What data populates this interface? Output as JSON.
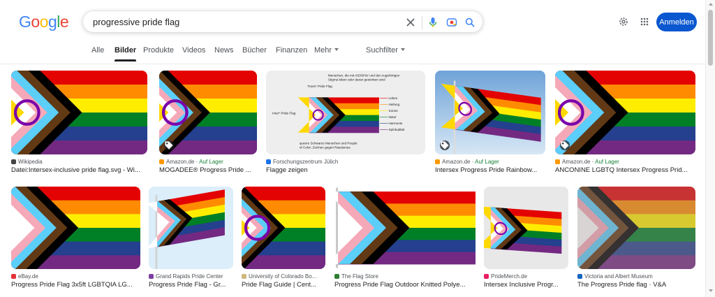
{
  "logo": [
    "G",
    "o",
    "o",
    "g",
    "l",
    "e"
  ],
  "logo_colors": [
    "#4285f4",
    "#ea4335",
    "#fbbc05",
    "#4285f4",
    "#34a853",
    "#ea4335"
  ],
  "search": {
    "query": "progressive pride flag"
  },
  "header": {
    "signin_label": "Anmelden"
  },
  "tabs": [
    "Alle",
    "Bilder",
    "Produkte",
    "Videos",
    "News",
    "Bücher",
    "Finanzen",
    "Mehr",
    "Suchfilter"
  ],
  "active_tab": "Bilder",
  "stock_label": "Auf Lager",
  "results": [
    {
      "source": "Wikipedia",
      "title": "Datei:Intersex-inclusive pride flag.svg - Wi...",
      "in_stock": false,
      "tag": false,
      "fav": "#444444",
      "variant": "intersex"
    },
    {
      "source": "Amazon.de",
      "title": "MOGADEE® Progress Pride ...",
      "in_stock": true,
      "tag": true,
      "fav": "#ff9900",
      "variant": "intersex"
    },
    {
      "source": "Forschungszentrum Jülich",
      "title": "Flagge zeigen",
      "in_stock": false,
      "tag": false,
      "fav": "#1a73e8",
      "variant": "diagram",
      "diagram": {
        "trans": "Trans* Pride Flag",
        "inter": "Inter* Pride Flag",
        "aids": "Menschen, die mit AIDS/HIV und den zugehörigen Stigma leben oder daran gestorben sind",
        "poc": "queere Schwarze Menschen und People of Color; Zeichen gegen Rassismus",
        "meanings": [
          "Leben",
          "Heilung",
          "Sonne",
          "Natur",
          "Harmonie",
          "Spiritualität"
        ]
      }
    },
    {
      "source": "Amazon.de",
      "title": "Intersex Progress Pride Rainbow...",
      "in_stock": true,
      "tag": true,
      "fav": "#ff9900",
      "variant": "photo-sky"
    },
    {
      "source": "Amazon.de",
      "title": "ANCONINE LGBTQ Intersex Progress Prid...",
      "in_stock": true,
      "tag": true,
      "fav": "#ff9900",
      "variant": "intersex"
    },
    {
      "source": "eBay.de",
      "title": "Progress Pride Flag 3x5ft LGBTQIA LG...",
      "in_stock": false,
      "tag": false,
      "fav": "#e53238",
      "variant": "progress"
    },
    {
      "source": "Grand Rapids Pride Center",
      "title": "Progress Pride Flag - Gr...",
      "in_stock": false,
      "tag": false,
      "fav": "#7b3fa0",
      "variant": "waving"
    },
    {
      "source": "University of Colorado Bo...",
      "title": "Pride Flag Guide | Cent...",
      "in_stock": false,
      "tag": false,
      "fav": "#cfb87c",
      "variant": "intersex"
    },
    {
      "source": "The Flag Store",
      "title": "Progress Pride Flag Outdoor Knitted Polye...",
      "in_stock": false,
      "tag": false,
      "fav": "#2e7d32",
      "variant": "progress-pole"
    },
    {
      "source": "PrideMerch.de",
      "title": "Intersex Inclusive Progr...",
      "in_stock": false,
      "tag": false,
      "fav": "#e91e63",
      "variant": "intersex-small"
    },
    {
      "source": "Victoria and Albert Museum",
      "title": "The Progress Pride flag · V&A",
      "in_stock": false,
      "tag": false,
      "fav": "#1565c0",
      "variant": "fabric"
    }
  ],
  "colors": {
    "rainbow": [
      "#e40303",
      "#ff8c00",
      "#ffed00",
      "#008026",
      "#24408e",
      "#732982"
    ],
    "chevrons": [
      "#ffffff",
      "#f5a9b8",
      "#5bcefa",
      "#613915",
      "#000000"
    ],
    "intersex_yellow": "#ffd800",
    "intersex_purple": "#7902aa"
  }
}
